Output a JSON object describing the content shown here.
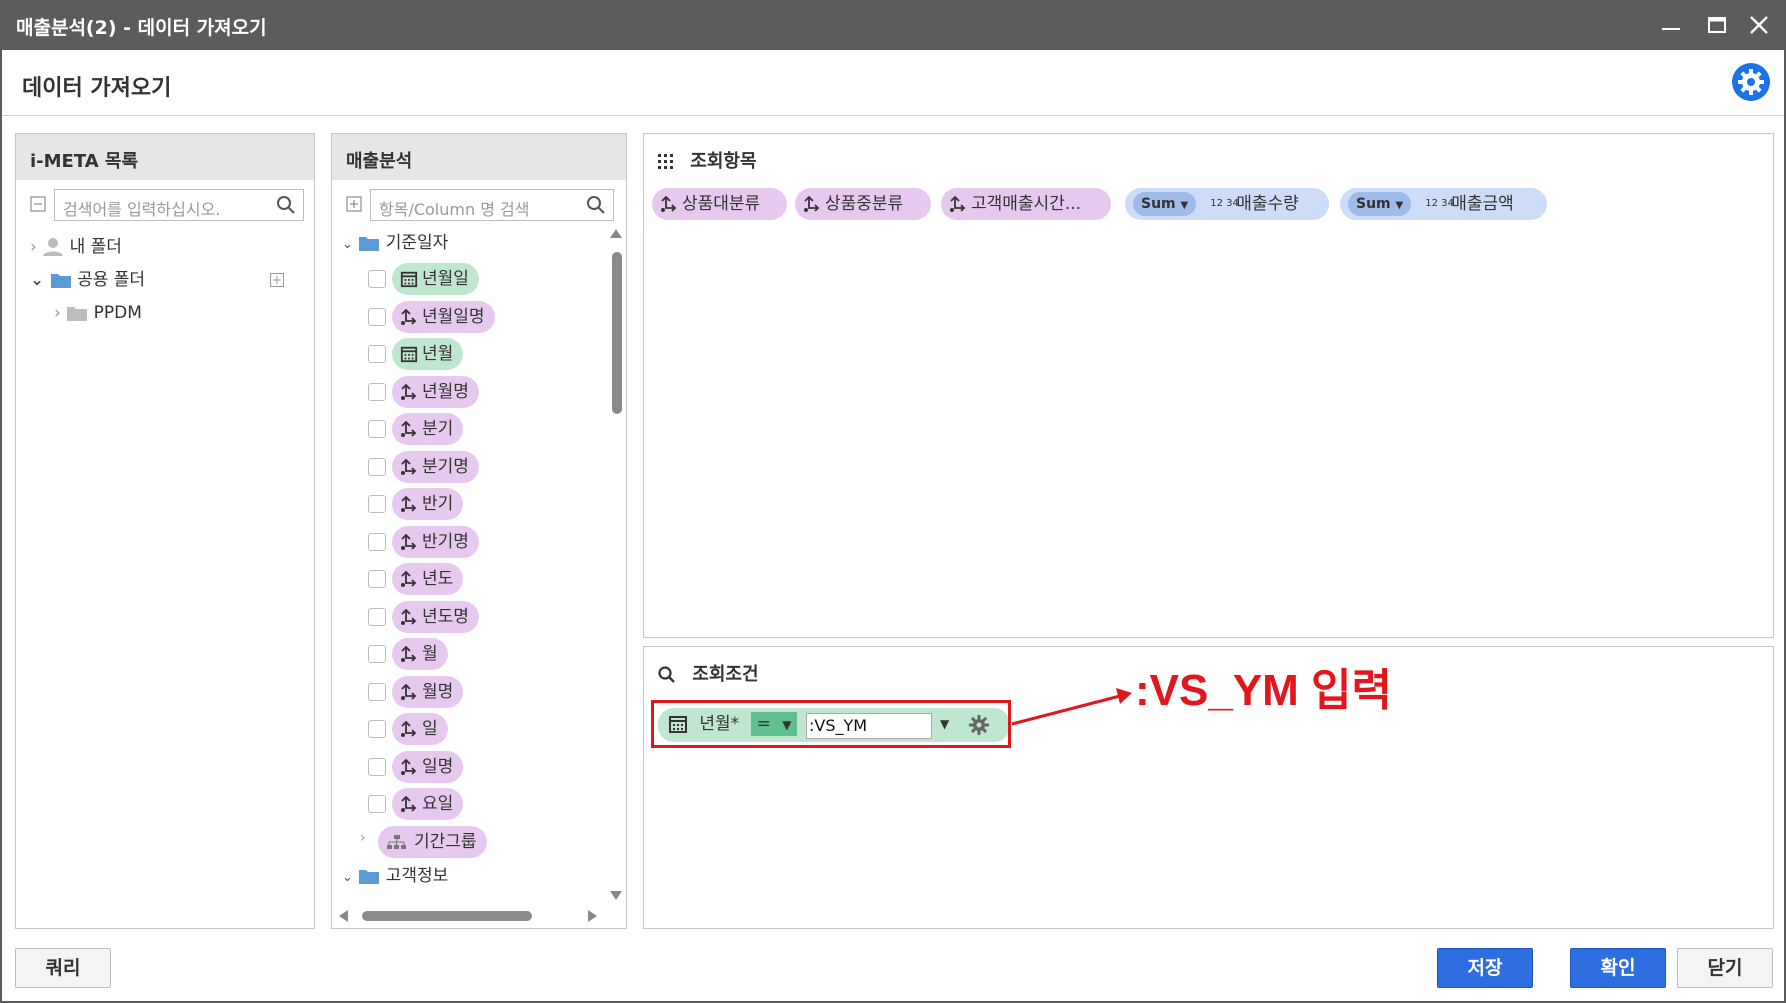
{
  "window": {
    "title": "매출분석(2) - 데이터 가져오기",
    "subtitle": "데이터 가져오기"
  },
  "meta_panel": {
    "title": "i-META 목록",
    "search_placeholder": "검색어를 입력하십시오.",
    "tree": [
      {
        "label": "내 폴더"
      },
      {
        "label": "공용 폴더"
      },
      {
        "label": "PPDM"
      }
    ]
  },
  "sales_panel": {
    "title": "매출분석",
    "search_placeholder": "항목/Column 명 검색",
    "folder1": "기준일자",
    "items": [
      {
        "label": "년월일",
        "kind": "calendar"
      },
      {
        "label": "년월일명",
        "kind": "dimension"
      },
      {
        "label": "년월",
        "kind": "calendar"
      },
      {
        "label": "년월명",
        "kind": "dimension"
      },
      {
        "label": "분기",
        "kind": "dimension"
      },
      {
        "label": "분기명",
        "kind": "dimension"
      },
      {
        "label": "반기",
        "kind": "dimension"
      },
      {
        "label": "반기명",
        "kind": "dimension"
      },
      {
        "label": "년도",
        "kind": "dimension"
      },
      {
        "label": "년도명",
        "kind": "dimension"
      },
      {
        "label": "월",
        "kind": "dimension"
      },
      {
        "label": "월명",
        "kind": "dimension"
      },
      {
        "label": "일",
        "kind": "dimension"
      },
      {
        "label": "일명",
        "kind": "dimension"
      },
      {
        "label": "요일",
        "kind": "dimension"
      }
    ],
    "group": "기간그룹",
    "folder2": "고객정보"
  },
  "query_panel": {
    "title": "조회항목",
    "chips": [
      {
        "label": "상품대분류"
      },
      {
        "label": "상품중분류"
      },
      {
        "label": "고객매출시간..."
      }
    ],
    "measures": [
      {
        "agg": "Sum",
        "num": "12 34",
        "label": "매출수량"
      },
      {
        "agg": "Sum",
        "num": "12 34",
        "label": "매출금액"
      }
    ]
  },
  "cond_panel": {
    "title": "조회조건",
    "field": "년월*",
    "operator": "=",
    "value": ":VS_YM"
  },
  "annotation": ":VS_YM 입력",
  "buttons": {
    "query": "쿼리",
    "save": "저장",
    "ok": "확인",
    "close": "닫기"
  },
  "colors": {
    "dim_chip": "#e7c9ef",
    "date_chip": "#bfe6cf",
    "measure_chip": "#cdddf7",
    "accent": "#2f6ee0",
    "annotation": "#e2161d"
  }
}
